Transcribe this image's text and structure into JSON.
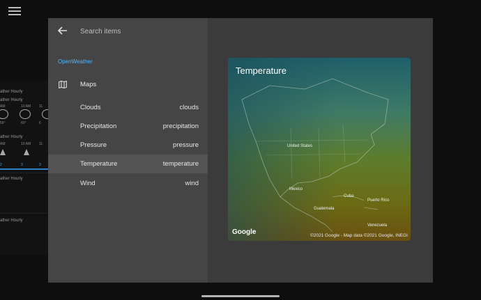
{
  "background": {
    "cards": [
      {
        "title": "ather Hourly",
        "times": [
          "AM",
          "10 AM",
          "11"
        ],
        "values": [
          "56°",
          "60°",
          "6"
        ],
        "kind": "sun"
      },
      {
        "title": "ather Hourly",
        "times": [
          "AM",
          "10 AM",
          "11"
        ],
        "values": [
          "2",
          "3",
          "3"
        ],
        "kind": "arrow"
      },
      {
        "title": "ather Hourly",
        "times": [],
        "values": [],
        "kind": "empty"
      },
      {
        "title": "ather Hourly",
        "times": [],
        "values": [],
        "kind": "empty"
      }
    ]
  },
  "search": {
    "placeholder": "Search items"
  },
  "integration": "OpenWeather",
  "group": {
    "label": "Maps"
  },
  "items": [
    {
      "label": "Clouds",
      "value": "clouds"
    },
    {
      "label": "Precipitation",
      "value": "precipitation"
    },
    {
      "label": "Pressure",
      "value": "pressure"
    },
    {
      "label": "Temperature",
      "value": "temperature",
      "active": true
    },
    {
      "label": "Wind",
      "value": "wind"
    }
  ],
  "map": {
    "title": "Temperature",
    "logo": "Google",
    "attribution": "©2021 Google - Map data ©2021 Google, INEGI",
    "places": [
      "United States",
      "Mexico",
      "Cuba",
      "Puerto Rico",
      "Guatemala",
      "Venezuela"
    ]
  },
  "colors": {
    "accent": "#4fb8ff",
    "active_row": "#545454"
  },
  "icons": {
    "menu": "menu-icon",
    "back": "arrow-left-icon",
    "maps": "map-icon"
  }
}
